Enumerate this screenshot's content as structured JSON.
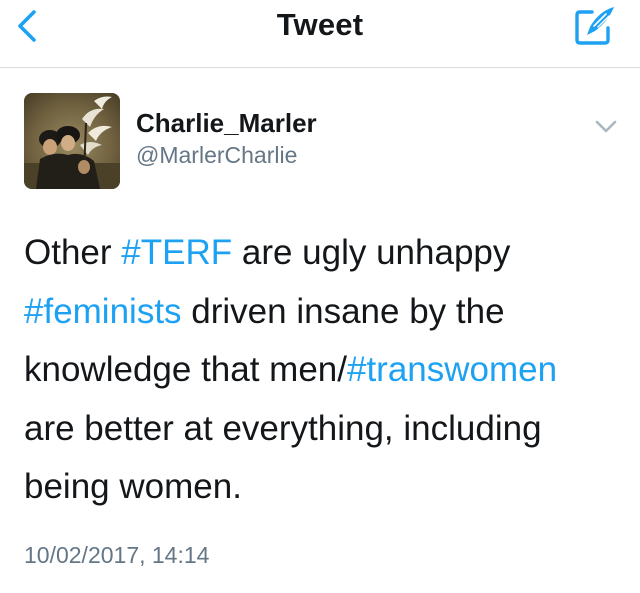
{
  "nav": {
    "title": "Tweet",
    "back_icon": "chevron-left-icon",
    "compose_icon": "compose-quill-icon"
  },
  "tweet": {
    "author": {
      "display_name": "Charlie_Marler",
      "handle": "@MarlerCharlie",
      "avatar": "painting-avatar"
    },
    "menu_icon": "chevron-down-icon",
    "text_lines": [
      [
        {
          "t": "Other ",
          "tag": false
        },
        {
          "t": "#TERF",
          "tag": true
        },
        {
          "t": " are ugly unhappy",
          "tag": false
        }
      ],
      [
        {
          "t": "#feminists",
          "tag": true
        },
        {
          "t": " driven insane by the",
          "tag": false
        }
      ],
      [
        {
          "t": "knowledge that men/",
          "tag": false
        },
        {
          "t": "#transwomen",
          "tag": true
        }
      ],
      [
        {
          "t": "are better at everything, including",
          "tag": false
        }
      ],
      [
        {
          "t": "being women.",
          "tag": false
        }
      ]
    ],
    "timestamp": "10/02/2017, 14:14"
  },
  "colors": {
    "accent": "#1da1f2",
    "text": "#14171a",
    "secondary_text": "#657786",
    "divider": "#d9dde1"
  }
}
